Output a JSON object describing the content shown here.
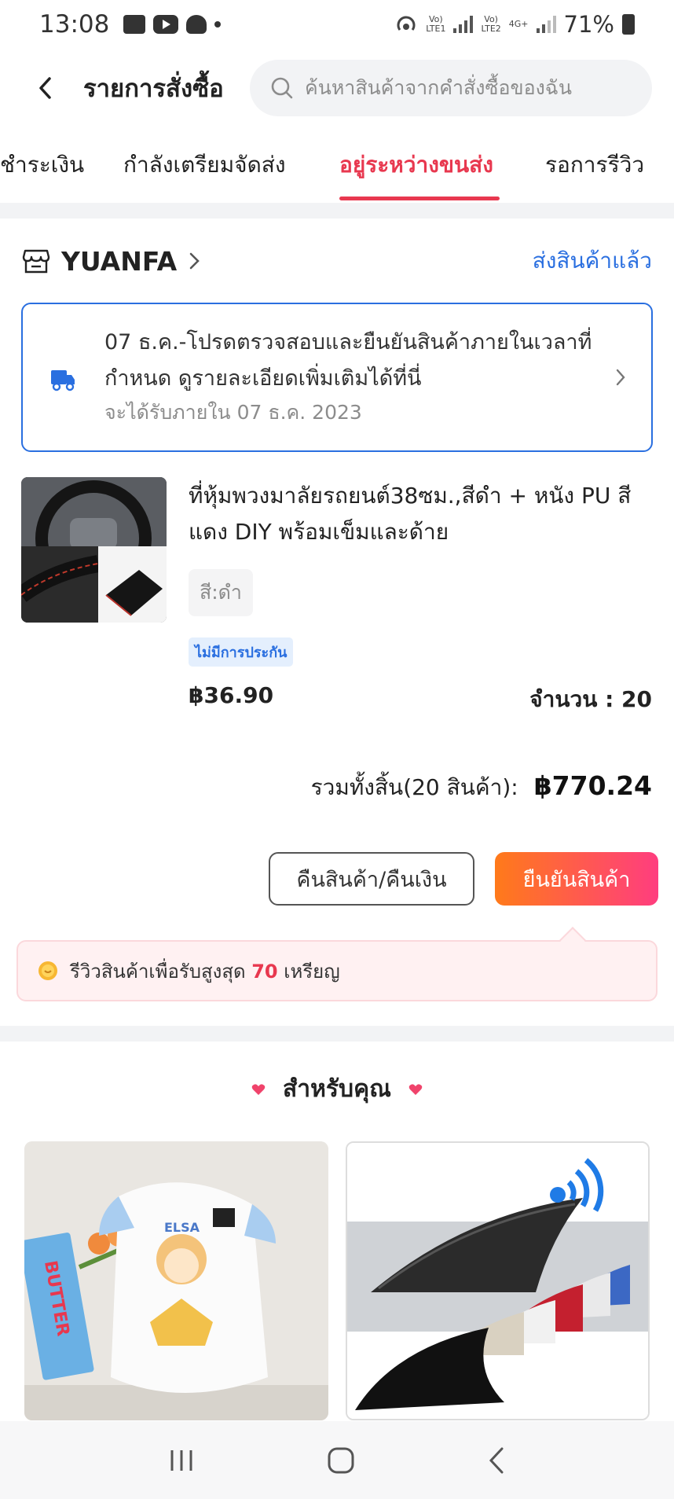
{
  "status_bar": {
    "time": "13:08",
    "net1_line1": "Vo)",
    "net1_line2": "LTE1",
    "net2_line1": "Vo)",
    "net2_line2": "LTE2",
    "net2_type": "4G+",
    "battery": "71%"
  },
  "header": {
    "title": "รายการสั่งซื้อ",
    "search_placeholder": "ค้นหาสินค้าจากคำสั่งซื้อของฉัน"
  },
  "tabs": [
    {
      "label": "ชำระเงิน",
      "active": false
    },
    {
      "label": "กำลังเตรียมจัดส่ง",
      "active": false
    },
    {
      "label": "อยู่ระหว่างขนส่ง",
      "active": true
    },
    {
      "label": "รอการรีวิว",
      "active": false
    }
  ],
  "order": {
    "shop_name": "YUANFA",
    "status": "ส่งสินค้าแล้ว",
    "notice_text": "07 ธ.ค.-โปรดตรวจสอบและยืนยันสินค้าภายในเวลาที่กำหนด ดูรายละเอียดเพิ่มเติมได้ที่นี่",
    "notice_sub": "จะได้รับภายใน 07 ธ.ค. 2023",
    "product_title": "ที่หุ้มพวงมาลัยรถยนต์38ซม.,สีดำ + หนัง PU สีแดง DIY พร้อมเข็มและด้าย",
    "variant": "สี:ดำ",
    "warranty": "ไม่มีการประกัน",
    "price": "฿36.90",
    "quantity": "จำนวน : 20",
    "total_label": "รวมทั้งสิ้น(20 สินค้า):",
    "total_value": "฿770.24",
    "return_label": "คืนสินค้า/คืนเงิน",
    "confirm_label": "ยืนยันสินค้า"
  },
  "review_banner": {
    "prefix": "รีวิวสินค้าเพื่อรับสูงสุด ",
    "coins": "70",
    "suffix": " เหรียญ"
  },
  "recommendations": {
    "title": "สำหรับคุณ",
    "left_card_print": "BUTTER",
    "left_card_name": "ELSA"
  },
  "colors": {
    "accent": "#e8384f",
    "link_blue": "#2a6fe0",
    "confirm_gradient_start": "#ff7a1a",
    "confirm_gradient_end": "#ff3d7f"
  }
}
